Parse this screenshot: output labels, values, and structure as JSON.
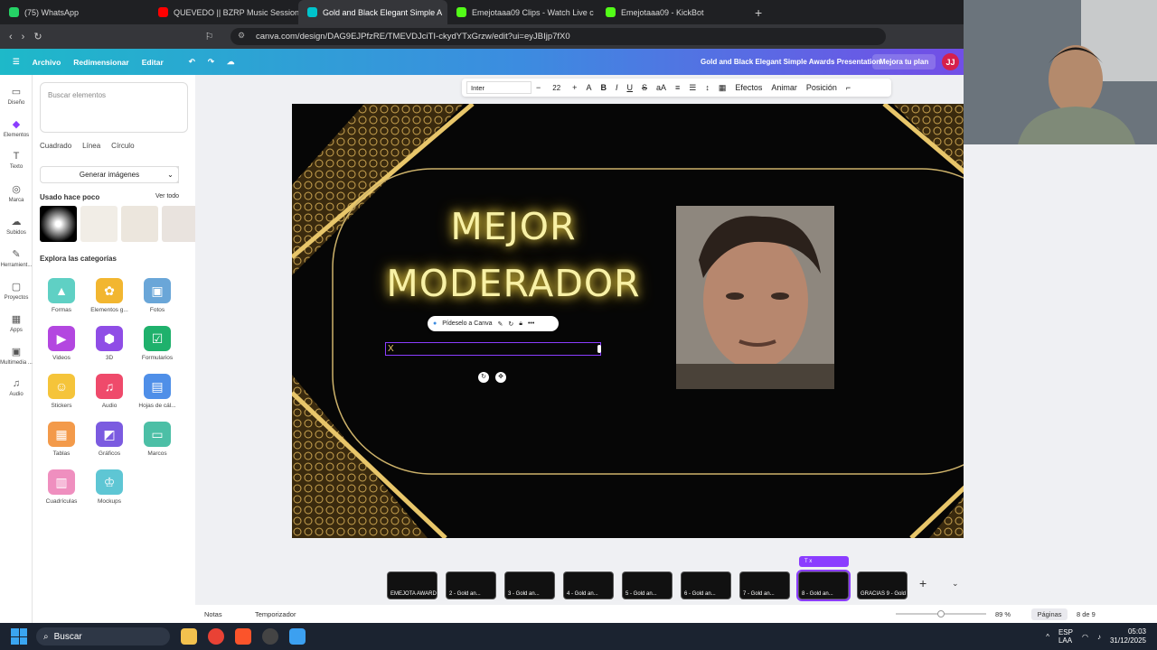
{
  "browser": {
    "tabs": [
      {
        "label": "(75) WhatsApp",
        "color": "#25d366"
      },
      {
        "label": "QUEVEDO || BZRP Music Sessions #52",
        "color": "#ff0000"
      },
      {
        "label": "Gold and Black Elegant Simple A",
        "color": "#00c4cc"
      },
      {
        "label": "Emejotaaa09 Clips - Watch Live c",
        "color": "#53fc18"
      },
      {
        "label": "Emejotaaa09 - KickBot",
        "color": "#53fc18"
      }
    ],
    "url": "canva.com/design/DAG9EJPfzRE/TMEVDJciTI-ckydYTxGrzw/edit?ui=eyJBIjp7fX0"
  },
  "header": {
    "file_label": "Archivo",
    "resize_label": "Redimensionar",
    "edit_label": "Editar",
    "design_title": "Gold and Black Elegant Simple Awards Presentation",
    "upgrade_label": "Mejora tu plan",
    "avatar_initials": "JJ"
  },
  "rail": [
    {
      "label": "Diseño",
      "icon": "layout-icon"
    },
    {
      "label": "Elementos",
      "icon": "elements-icon"
    },
    {
      "label": "Texto",
      "icon": "text-icon"
    },
    {
      "label": "Marca",
      "icon": "brand-icon"
    },
    {
      "label": "Subidos",
      "icon": "upload-icon"
    },
    {
      "label": "Herramient...",
      "icon": "tools-icon"
    },
    {
      "label": "Proyectos",
      "icon": "folder-icon"
    },
    {
      "label": "Apps",
      "icon": "apps-icon"
    },
    {
      "label": "Multimedia ...",
      "icon": "media-icon"
    },
    {
      "label": "Audio",
      "icon": "music-icon"
    }
  ],
  "panel": {
    "search_placeholder": "Buscar elementos",
    "chips": [
      "Cuadrado",
      "Línea",
      "Círculo"
    ],
    "generate_label": "Generar imágenes",
    "recent_heading": "Usado hace poco",
    "recent_all": "Ver todo",
    "categories_heading": "Explora las categorías",
    "categories": [
      {
        "label": "Formas",
        "color": "#5fd0c4"
      },
      {
        "label": "Elementos g...",
        "color": "#f2b630"
      },
      {
        "label": "Fotos",
        "color": "#6aa6d8"
      },
      {
        "label": "Videos",
        "color": "#b347e0"
      },
      {
        "label": "3D",
        "color": "#8f4de6"
      },
      {
        "label": "Formularios",
        "color": "#1fb16c"
      },
      {
        "label": "Stickers",
        "color": "#f5c43a"
      },
      {
        "label": "Audio",
        "color": "#ef4a6b"
      },
      {
        "label": "Hojas de cál...",
        "color": "#4f8fe8"
      },
      {
        "label": "Tablas",
        "color": "#f39a4a"
      },
      {
        "label": "Gráficos",
        "color": "#7b5be0"
      },
      {
        "label": "Marcos",
        "color": "#4cbfa6"
      },
      {
        "label": "Cuadrículas",
        "color": "#ef8fbf"
      },
      {
        "label": "Mockups",
        "color": "#5ec6d4"
      }
    ]
  },
  "toolbar": {
    "font": "Inter",
    "size": "22",
    "effects": "Efectos",
    "animate": "Animar",
    "position": "Posición"
  },
  "slide": {
    "title_line1": "MEJOR",
    "title_line2": "MODERADOR",
    "ask_canva": "Pídeselo a Canva",
    "text_cursor": "X",
    "colors": {
      "gold": "#d4b457",
      "glow": "#f8f1a6",
      "selection": "#8b3dff"
    }
  },
  "pages": {
    "badge": "T  x",
    "items": [
      {
        "label": "EMEJOTA AWARDS"
      },
      {
        "label": "2 - Gold an..."
      },
      {
        "label": "3 - Gold an..."
      },
      {
        "label": "4 - Gold an..."
      },
      {
        "label": "5 - Gold an..."
      },
      {
        "label": "6 - Gold an..."
      },
      {
        "label": "7 - Gold an..."
      },
      {
        "label": "8 - Gold an..."
      },
      {
        "label": "GRACIAS 9 - Gold an..."
      }
    ],
    "selected": 8
  },
  "footer": {
    "notes": "Notas",
    "timer": "Temporizador",
    "zoom": "89 %",
    "zoom_level": 0.5,
    "pages_btn": "Páginas",
    "page_count": "8 de 9"
  },
  "taskbar": {
    "search": "Buscar",
    "lang1": "ESP",
    "lang2": "LAA",
    "time": "05:03",
    "date": "31/12/2025"
  }
}
